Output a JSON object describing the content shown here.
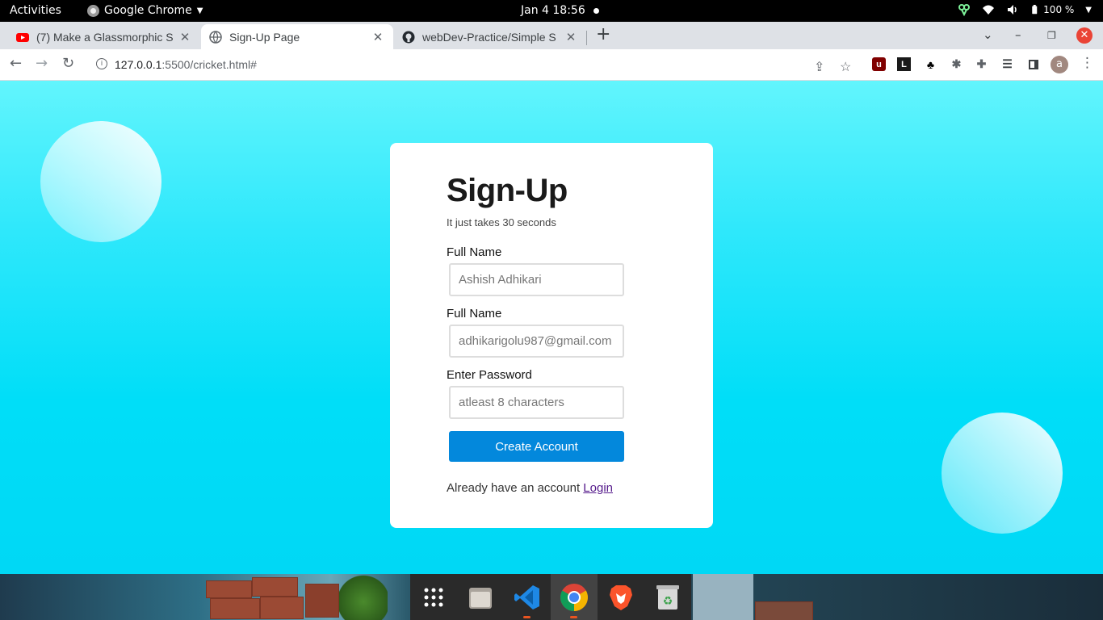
{
  "topbar": {
    "activities": "Activities",
    "app_name": "Google Chrome",
    "clock": "Jan 4  18:56",
    "battery": "100 %"
  },
  "tabs": [
    {
      "title": "(7) Make a Glassmorphic S",
      "icon": "youtube-icon",
      "active": false
    },
    {
      "title": "Sign-Up Page",
      "icon": "globe-icon",
      "active": true
    },
    {
      "title": "webDev-Practice/Simple S",
      "icon": "github-icon",
      "active": false
    }
  ],
  "address_bar": {
    "host": "127.0.0.1",
    "path": ":5500/cricket.html#"
  },
  "profile_initial": "a",
  "extensions": [
    "ublock-icon",
    "lighthouse-icon",
    "gnome-icon",
    "bug-icon",
    "puzzle-icon",
    "media-queue-icon",
    "side-panel-icon"
  ],
  "form": {
    "heading": "Sign-Up",
    "subheading": "It just takes 30 seconds",
    "fields": [
      {
        "label": "Full Name",
        "placeholder": "Ashish Adhikari",
        "type": "text"
      },
      {
        "label": "Full Name",
        "placeholder": "adhikarigolu987@gmail.com",
        "type": "email"
      },
      {
        "label": "Enter Password",
        "placeholder": "atleast 8 characters",
        "type": "password"
      }
    ],
    "submit_label": "Create Account",
    "login_prompt": "Already have an account",
    "login_link": "Login"
  },
  "colors": {
    "background_top": "#62f5fd",
    "background_bottom": "#00d8f5",
    "button": "#0388dc",
    "link": "#551a8b"
  },
  "dock": {
    "items": [
      "app-grid-icon",
      "files-icon",
      "vscode-icon",
      "chrome-icon",
      "brave-icon",
      "trash-icon"
    ]
  }
}
